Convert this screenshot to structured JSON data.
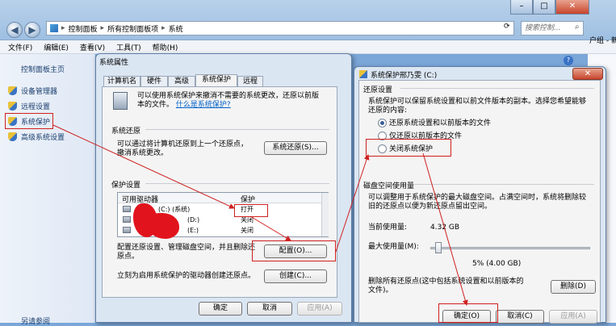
{
  "explorer": {
    "breadcrumb": [
      "控制面板",
      "所有控制面板项",
      "系统"
    ],
    "search_placeholder": "搜索控制...",
    "menu": [
      "文件(F)",
      "编辑(E)",
      "查看(V)",
      "工具(T)",
      "帮助(H)"
    ],
    "left_home": "控制面板主页",
    "left_items": [
      "设备管理器",
      "远程设置",
      "系统保护",
      "高级系统设置"
    ],
    "left_bottom": "另请参阅",
    "right_edge_text": "户组 - 新"
  },
  "sysprops": {
    "title": "系统属性",
    "tabs": [
      "计算机名",
      "硬件",
      "高级",
      "系统保护",
      "远程"
    ],
    "active_tab": "系统保护",
    "intro_line1": "可以使用系统保护来撤消不需要的系统更改，还原以前版",
    "intro_line2": "本的文件。",
    "intro_link": "什么是系统保护?",
    "restore_group": "系统还原",
    "restore_text1": "可以通过将计算机还原到上一个还原点，",
    "restore_text2": "撤消系统更改。",
    "restore_button": "系统还原(S)...",
    "protect_group": "保护设置",
    "col_drive": "可用驱动器",
    "col_protect": "保护",
    "drives": [
      {
        "name": "(C:) (系统)",
        "status": "打开"
      },
      {
        "name": "(D:)",
        "status": "关闭"
      },
      {
        "name": "(E:)",
        "status": "关闭"
      }
    ],
    "config_text1": "配置还原设置、管理磁盘空间，并且删除还",
    "config_text2": "原点。",
    "config_button": "配置(O)...",
    "create_text": "立刻为启用系统保护的驱动器创建还原点。",
    "create_button": "创建(C)...",
    "ok": "确定",
    "cancel": "取消",
    "apply": "应用(A)"
  },
  "protect_dlg": {
    "title": "系统保护邢乃雯 (C:)",
    "restore_settings": "还原设置",
    "desc1": "系统保护可以保留系统设置和以前文件版本的副本。选择您希望能够",
    "desc2": "还原的内容:",
    "options": [
      "还原系统设置和以前版本的文件",
      "仅还原以前版本的文件",
      "关闭系统保护"
    ],
    "selected_option": 0,
    "disk_group": "磁盘空间使用量",
    "disk_desc1": "可以调整用于系统保护的最大磁盘空间。占满空间时，系统将删除较",
    "disk_desc2": "旧的还原点以便为新还原点留出空间。",
    "current_label": "当前使用量:",
    "current_value": "4.32 GB",
    "max_label": "最大使用量(M):",
    "slider_fraction": 0.05,
    "slider_readout": "5% (4.00 GB)",
    "delete_text1": "删除所有还原点(这中包括系统设置和以前版本的",
    "delete_text2": "文件)。",
    "delete_button": "删除(D)",
    "ok": "确定(O)",
    "cancel": "取消(C)",
    "apply": "应用(A)"
  },
  "colors": {
    "annotation_red": "#d02020",
    "title_blue": "#1a3e6e"
  }
}
